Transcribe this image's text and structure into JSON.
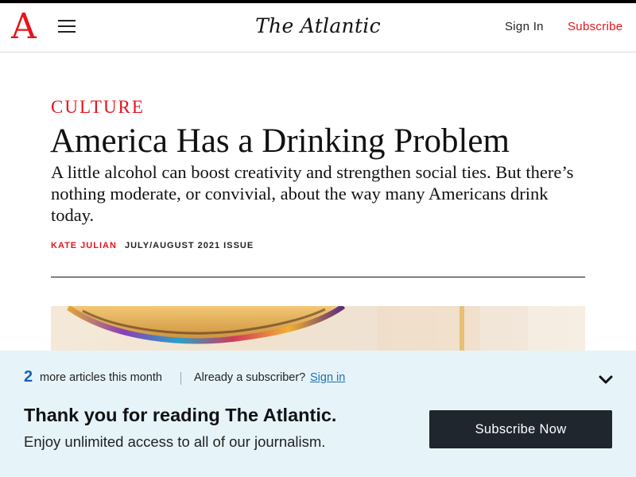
{
  "header": {
    "logo_letter": "A",
    "masthead": "The Atlantic",
    "sign_in": "Sign In",
    "subscribe": "Subscribe"
  },
  "article": {
    "section": "CULTURE",
    "headline": "America Has a Drinking Problem",
    "dek": "A little alcohol can boost creativity and strengthen social ties. But there’s nothing moderate, or convivial, about the way many Americans drink today.",
    "author": "KATE JULIAN",
    "issue": "JULY/AUGUST 2021 ISSUE"
  },
  "paywall": {
    "article_count": "2",
    "count_label": "more articles this month",
    "already_subscriber": "Already a subscriber?",
    "sign_in_link": "Sign in",
    "thanks_title": "Thank you for reading The Atlantic.",
    "thanks_body": "Enjoy unlimited access to all of our journalism.",
    "cta": "Subscribe Now"
  },
  "icons": {
    "menu": "hamburger-menu-icon",
    "collapse": "chevron-down-icon"
  },
  "colors": {
    "brand_red": "#e7131a",
    "banner_bg": "#e6f4f9",
    "cta_bg": "#20262e",
    "count_blue": "#1560bd",
    "link_blue": "#1e6fb3"
  }
}
